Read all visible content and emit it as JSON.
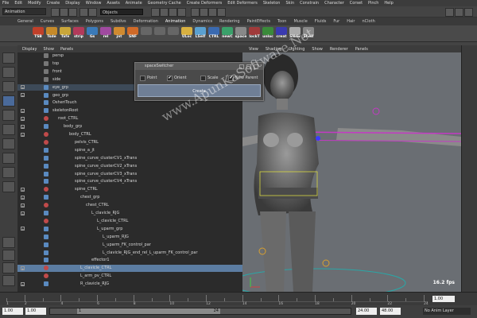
{
  "menubar": [
    "File",
    "Edit",
    "Modify",
    "Create",
    "Display",
    "Window",
    "Assets",
    "Animate",
    "Geometry Cache",
    "Create Deformers",
    "Edit Deformers",
    "Skeleton",
    "Skin",
    "Constrain",
    "Character",
    "Corset",
    "Pinch",
    "Help"
  ],
  "status": {
    "mode": "Animation",
    "object_field": "Objects"
  },
  "shelf_tabs": [
    "General",
    "Curves",
    "Surfaces",
    "Polygons",
    "Subdivs",
    "Deformation",
    "Animation",
    "Dynamics",
    "Rendering",
    "PaintEffects",
    "Toon",
    "Muscle",
    "Fluids",
    "Fur",
    "Hair",
    "nCloth"
  ],
  "shelf_active": "Animation",
  "shelf_icons": [
    {
      "label": "TSB",
      "color": "#c0402a"
    },
    {
      "label": "Tsde",
      "color": "#c58a2a"
    },
    {
      "label": "Tafe",
      "color": "#c9a63a"
    },
    {
      "label": "strip",
      "color": "#b23a5a"
    },
    {
      "label": "Gs",
      "color": "#3a7ab8"
    },
    {
      "label": "rel",
      "color": "#a04aa0"
    },
    {
      "label": "jnt",
      "color": "#d08a30"
    },
    {
      "label": "SNF",
      "color": "#d06a28"
    },
    {
      "label": "",
      "color": "#666"
    },
    {
      "label": "",
      "color": "#666"
    },
    {
      "label": "",
      "color": "#666"
    },
    {
      "label": "ULoc",
      "color": "#d8b040"
    },
    {
      "label": "LSelf",
      "color": "#5aa0d0"
    },
    {
      "label": "CTRL",
      "color": "#3a6ab0"
    },
    {
      "label": "newC",
      "color": "#3aa06a"
    },
    {
      "label": "space",
      "color": "#888"
    },
    {
      "label": "lockT",
      "color": "#a03a3a"
    },
    {
      "label": "unloc",
      "color": "#3a8a3a"
    },
    {
      "label": "creat",
      "color": "#3a3ab0"
    },
    {
      "label": "SNsw",
      "color": "#aaa"
    },
    {
      "label": "Shelf",
      "color": "#888"
    }
  ],
  "outliner": {
    "menu": [
      "Display",
      "Show",
      "Panels"
    ],
    "rows": [
      {
        "label": "persp",
        "indent": 0,
        "expand": ""
      },
      {
        "label": "top",
        "indent": 0,
        "expand": ""
      },
      {
        "label": "front",
        "indent": 0,
        "expand": ""
      },
      {
        "label": "side",
        "indent": 0,
        "expand": ""
      },
      {
        "label": "eye_grp",
        "indent": 0,
        "expand": "+"
      },
      {
        "label": "geo_grp",
        "indent": 0,
        "expand": "+"
      },
      {
        "label": "OsheriTouch",
        "indent": 0,
        "expand": ""
      },
      {
        "label": "skeletonRoot",
        "indent": 0,
        "expand": "+"
      },
      {
        "label": "root_CTRL",
        "indent": 1,
        "expand": "+"
      },
      {
        "label": "body_grp",
        "indent": 2,
        "expand": "+"
      },
      {
        "label": "body_CTRL",
        "indent": 3,
        "expand": "+"
      },
      {
        "label": "pelvis_CTRL",
        "indent": 4,
        "expand": ""
      },
      {
        "label": "spine_a_jt",
        "indent": 4,
        "expand": ""
      },
      {
        "label": "spine_curve_clusterCV1_xTrans",
        "indent": 4,
        "expand": ""
      },
      {
        "label": "spine_curve_clusterCV2_xTrans",
        "indent": 4,
        "expand": ""
      },
      {
        "label": "spine_curve_clusterCV3_xTrans",
        "indent": 4,
        "expand": ""
      },
      {
        "label": "spine_curve_clusterCV4_xTrans",
        "indent": 4,
        "expand": ""
      },
      {
        "label": "spine_CTRL",
        "indent": 4,
        "expand": "+"
      },
      {
        "label": "chest_grp",
        "indent": 5,
        "expand": "+"
      },
      {
        "label": "chest_CTRL",
        "indent": 6,
        "expand": "+"
      },
      {
        "label": "L_clavicle_RJG",
        "indent": 7,
        "expand": "+"
      },
      {
        "label": "L_clavicle_CTRL",
        "indent": 8,
        "expand": ""
      },
      {
        "label": "L_uparm_grp",
        "indent": 8,
        "expand": "+"
      },
      {
        "label": "L_uparm_RJG",
        "indent": 9,
        "expand": ""
      },
      {
        "label": "L_uparm_FK_control_par",
        "indent": 9,
        "expand": ""
      },
      {
        "label": "L_clavicle_RJG_end_rel_L_uparm_FK_control_par",
        "indent": 9,
        "expand": ""
      },
      {
        "label": "effector1",
        "indent": 7,
        "expand": ""
      },
      {
        "label": "L_clavicle_CTRL",
        "indent": 5,
        "expand": "+"
      },
      {
        "label": "L_arm_pv_CTRL",
        "indent": 5,
        "expand": ""
      },
      {
        "label": "R_clavicle_RJG",
        "indent": 5,
        "expand": "+"
      }
    ],
    "selected_index": 27
  },
  "dialog": {
    "title": "spaceSwitcher",
    "options": [
      {
        "label": "Point",
        "checked": false
      },
      {
        "label": "Orient",
        "checked": true
      },
      {
        "label": "Scale",
        "checked": false
      },
      {
        "label": "New Parent",
        "checked": true
      }
    ],
    "create_label": "Create"
  },
  "viewport": {
    "menu": [
      "View",
      "Shading",
      "Lighting",
      "Show",
      "Renderer",
      "Panels"
    ],
    "fps": "16.2 fps"
  },
  "watermark": "www.ApunKaSoftware.Net",
  "timeline": {
    "current_frame": "1.00",
    "tick_labels": [
      "1",
      "2",
      "4",
      "6",
      "8",
      "10",
      "12",
      "14",
      "16",
      "18",
      "20",
      "22",
      "24"
    ]
  },
  "range": {
    "start": "1.00",
    "inner_start": "1.00",
    "slider_label": "1",
    "slider_end": "24",
    "inner_end": "24.00",
    "end": "48.00",
    "anim_layer": "No Anim Layer"
  }
}
